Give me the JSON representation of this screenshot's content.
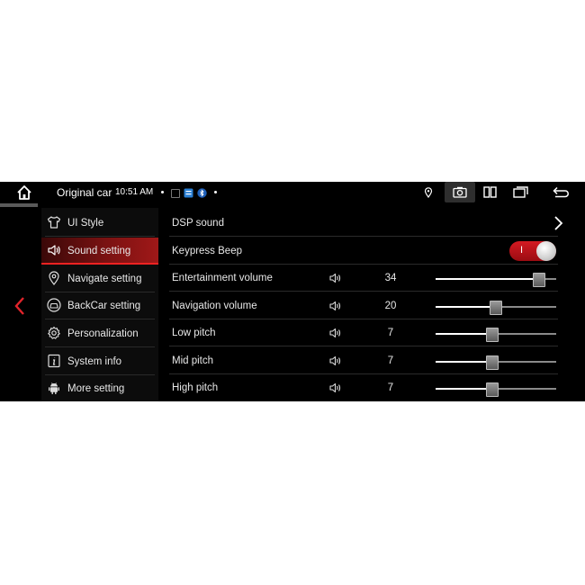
{
  "statusbar": {
    "title": "Original car",
    "time": "10:51 AM"
  },
  "menu": {
    "items": [
      {
        "label": "UI Style",
        "icon": "shirt-icon",
        "active": false
      },
      {
        "label": "Sound setting",
        "icon": "speaker-icon",
        "active": true
      },
      {
        "label": "Navigate setting",
        "icon": "location-pin-icon",
        "active": false
      },
      {
        "label": "BackCar setting",
        "icon": "car-icon",
        "active": false
      },
      {
        "label": "Personalization",
        "icon": "gear-icon",
        "active": false
      },
      {
        "label": "System info",
        "icon": "info-icon",
        "active": false
      },
      {
        "label": "More setting",
        "icon": "android-icon",
        "active": false
      }
    ]
  },
  "settings": {
    "dsp_label": "DSP sound",
    "keypress_label": "Keypress Beep",
    "keypress_on": true,
    "keypress_mark": "I",
    "volumes": [
      {
        "label": "Entertainment volume",
        "value": "34",
        "level": 0.85
      },
      {
        "label": "Navigation volume",
        "value": "20",
        "level": 0.49
      },
      {
        "label": "Low pitch",
        "value": "7",
        "level": 0.46
      },
      {
        "label": "Mid pitch",
        "value": "7",
        "level": 0.46
      },
      {
        "label": "High pitch",
        "value": "7",
        "level": 0.46
      }
    ]
  },
  "colors": {
    "accent": "#d41a22",
    "background": "#000000"
  }
}
